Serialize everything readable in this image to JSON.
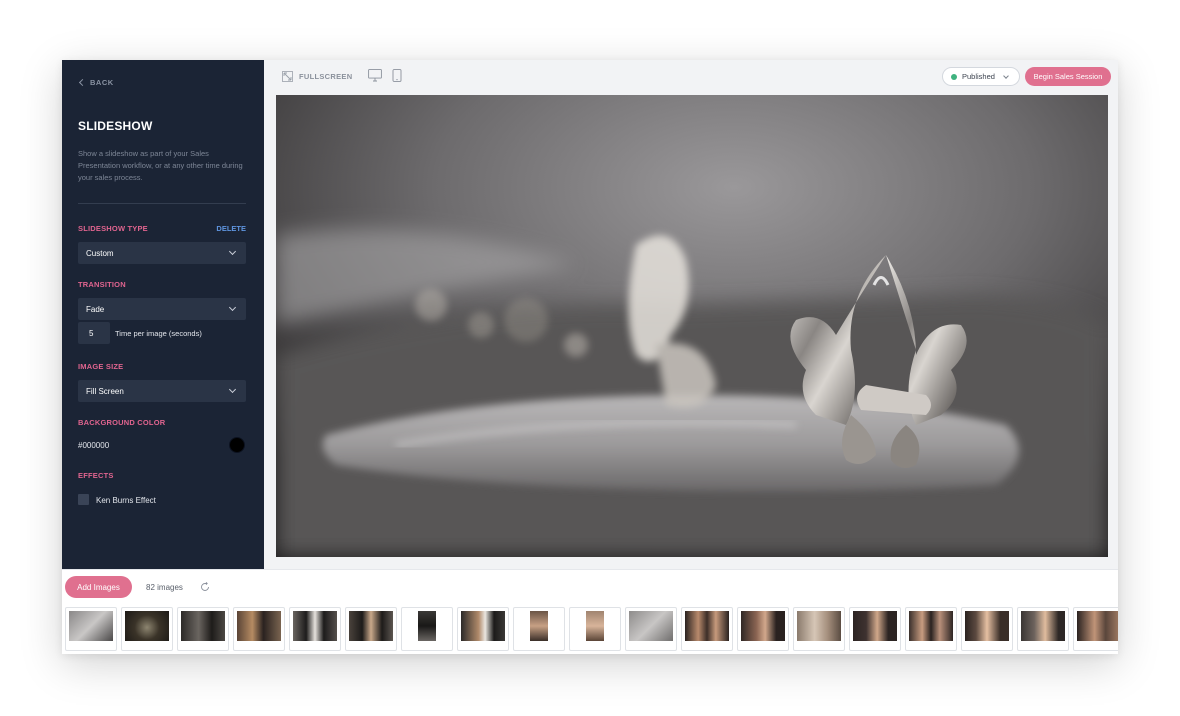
{
  "sidebar": {
    "back_label": "BACK",
    "title": "SLIDESHOW",
    "description": "Show a slideshow as part of your Sales Presentation workflow, or at any other time during your sales process.",
    "slideshow_type": {
      "label": "SLIDESHOW TYPE",
      "delete_label": "DELETE",
      "value": "Custom"
    },
    "transition": {
      "label": "TRANSITION",
      "value": "Fade",
      "time_value": "5",
      "time_label": "Time per image (seconds)"
    },
    "image_size": {
      "label": "IMAGE SIZE",
      "value": "Fill Screen"
    },
    "background_color": {
      "label": "BACKGROUND COLOR",
      "value": "#000000"
    },
    "effects": {
      "label": "EFFECTS",
      "ken_burns_label": "Ken Burns Effect",
      "ken_burns_checked": false
    }
  },
  "topbar": {
    "fullscreen_label": "FULLSCREEN",
    "status_label": "Published",
    "status_color": "#3fb27f",
    "begin_session_label": "Begin Sales Session"
  },
  "gallery": {
    "add_images_label": "Add Images",
    "count_label": "82 images",
    "thumbnail_count": 19
  },
  "colors": {
    "sidebar_bg": "#1b2435",
    "accent_pink": "#e0708f",
    "section_label": "#e0648f",
    "link_blue": "#5f95e0"
  }
}
